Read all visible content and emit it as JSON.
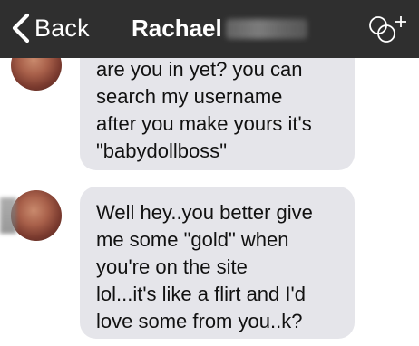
{
  "nav": {
    "back_label": "Back",
    "contact_first_name": "Rachael",
    "add_icon": "add-group-icon"
  },
  "colors": {
    "nav_background": "#2f2f2f",
    "bubble_incoming": "#e5e5ea",
    "text": "#111111"
  },
  "messages": [
    {
      "text": "are you in yet? you can\nsearch my username\nafter you make yours it's\n\"babydollboss\""
    },
    {
      "text": "Well hey..you better give\nme some \"gold\" when\nyou're on the site\nlol...it's like a flirt and I'd\nlove some from you..k?"
    }
  ]
}
